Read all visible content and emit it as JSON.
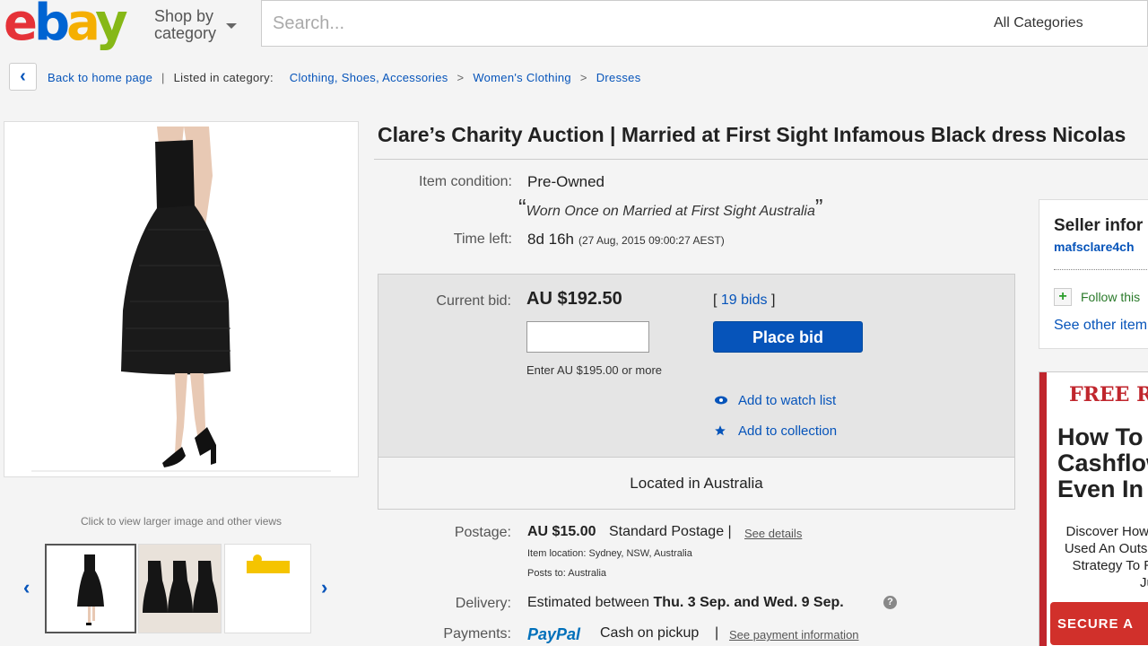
{
  "header": {
    "logo": {
      "e": "e",
      "b": "b",
      "a": "a",
      "y": "y"
    },
    "shop_by_line1": "Shop by",
    "shop_by_line2": "category",
    "search_placeholder": "Search...",
    "category_select": "All Categories"
  },
  "breadcrumb": {
    "back_icon": "chevron-left-icon",
    "back_glyph": "‹",
    "back_label": "Back to home page",
    "divider": "|",
    "listed_label": "Listed in category:",
    "items": [
      "Clothing, Shoes, Accessories",
      "Women's Clothing",
      "Dresses"
    ],
    "sep": ">"
  },
  "gallery": {
    "click_view": "Click to view larger image and other views",
    "prev": "‹",
    "next": "›"
  },
  "item": {
    "title": "Clare’s Charity Auction | Married at First Sight Infamous Black dress Nicolas",
    "condition_label": "Item condition:",
    "condition": "Pre-Owned",
    "quote_open": "“",
    "condition_note": "Worn Once on Married at First Sight Australia",
    "quote_close": "”",
    "time_left_label": "Time left:",
    "time_left": "8d 16h",
    "end_time": "(27 Aug, 2015   09:00:27 AEST)"
  },
  "bid": {
    "current_label": "Current bid:",
    "current": "AU $192.50",
    "bids_open": "[",
    "bids": "19 bids",
    "bids_close": "]",
    "place_bid": "Place bid",
    "enter_hint": "Enter AU $195.00 or more",
    "watch": "Add to watch list",
    "collection": "Add to collection",
    "located": "Located in Australia"
  },
  "postage": {
    "label": "Postage:",
    "price": "AU $15.00",
    "method": "Standard Postage |",
    "details": "See details",
    "location": "Item location:  Sydney, NSW, Australia",
    "posts_to": "Posts to:  Australia"
  },
  "delivery": {
    "label": "Delivery:",
    "text_pre": "Estimated between",
    "text_bold": "Thu. 3 Sep. and Wed. 9 Sep.",
    "info_glyph": "?"
  },
  "payments": {
    "label": "Payments:",
    "paypal": "PayPal",
    "cash": "Cash on pickup",
    "sep": "|",
    "info": "See payment information"
  },
  "seller": {
    "title": "Seller infor",
    "name": "mafsclare4ch",
    "follow_icon_glyph": "+",
    "follow": "Follow this",
    "other": "See other item"
  },
  "ad": {
    "free": "FREE R",
    "headline": [
      "How To",
      "Cashflow",
      "Even In C"
    ],
    "body": [
      "Discover How",
      "Used An Outsi",
      "Strategy To R",
      "Just"
    ],
    "cta": "SECURE A"
  },
  "colors": {
    "link": "#0654ba",
    "button": "#0654ba",
    "ad_red": "#c0262d"
  }
}
